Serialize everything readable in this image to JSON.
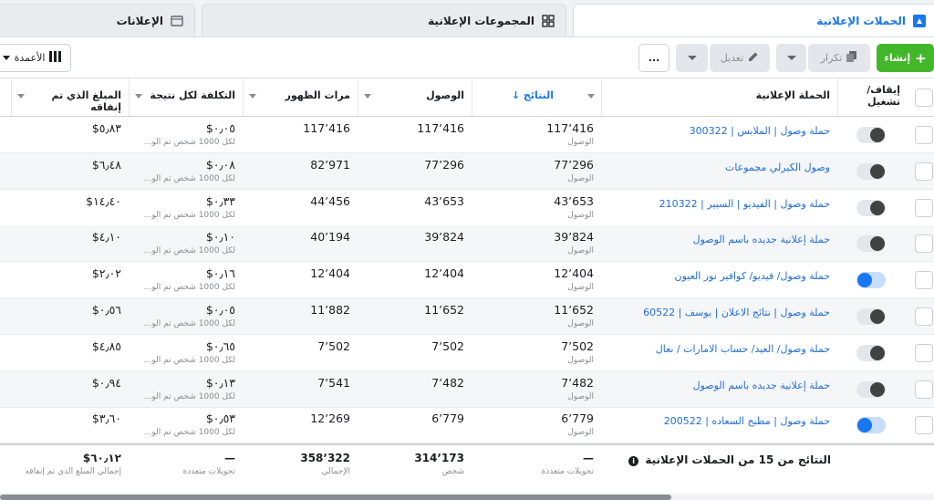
{
  "tabs": {
    "campaigns": "الحملات الإعلانية",
    "adsets": "المجموعات الإعلانية",
    "ads": "الإعلانات"
  },
  "toolbar": {
    "create": "إنشاء",
    "duplicate": "تكرار",
    "edit": "تعديل",
    "more": "...",
    "columns": "الأعمدة"
  },
  "headers": {
    "onoff": "إيقاف/تشغيل",
    "campaign": "الحملة الإعلانية",
    "results": "النتائج",
    "reach": "الوصول",
    "impressions": "مرات الظهور",
    "cost_per_result": "التكلفة لكل نتيجة",
    "amount_spent": "المبلغ الذي تم إنفاقه"
  },
  "rows": [
    {
      "name": "حملة وصول | الملابس | 300322",
      "on": false,
      "results": "117٬416",
      "results_sub": "الوصول",
      "reach": "117٬416",
      "impressions": "117٬416",
      "cost": "٠٫٠٥$",
      "cost_sub": "لكل 1000 شخص تم الو...",
      "spent": "٥٫٨٣$"
    },
    {
      "name": "وصول الكيرلي مجموعات",
      "on": false,
      "results": "77٬296",
      "results_sub": "الوصول",
      "reach": "77٬296",
      "impressions": "82٬971",
      "cost": "٠٫٠٨$",
      "cost_sub": "لكل 1000 شخص تم الو...",
      "spent": "٦٫٤٨$"
    },
    {
      "name": "حملة وصول | الفيديو | السبير | 210322",
      "on": false,
      "results": "43٬653",
      "results_sub": "الوصول",
      "reach": "43٬653",
      "impressions": "44٬456",
      "cost": "٠٫٣٣$",
      "cost_sub": "لكل 1000 شخص تم الو...",
      "spent": "١٤٫٤٠$"
    },
    {
      "name": "حملة إعلانية جديده باسم الوصول",
      "on": false,
      "results": "39٬824",
      "results_sub": "الوصول",
      "reach": "39٬824",
      "impressions": "40٬194",
      "cost": "٠٫١٠$",
      "cost_sub": "لكل 1000 شخص تم الو...",
      "spent": "٤٫١٠$"
    },
    {
      "name": "حملة وصول/ فيديو/ كوافير نور العيون",
      "on": true,
      "results": "12٬404",
      "results_sub": "الوصول",
      "reach": "12٬404",
      "impressions": "12٬404",
      "cost": "٠٫١٦$",
      "cost_sub": "لكل 1000 شخص تم الو...",
      "spent": "٢٫٠٢$"
    },
    {
      "name": "حملة وصول | نتائج الاعلان | يوسف | 60522",
      "on": false,
      "results": "11٬652",
      "results_sub": "الوصول",
      "reach": "11٬652",
      "impressions": "11٬882",
      "cost": "٠٫٠٥$",
      "cost_sub": "لكل 1000 شخص تم الو...",
      "spent": "٠٫٥٦$"
    },
    {
      "name": "حملة وصول/ العيد/ حساب الامارات / نعال",
      "on": false,
      "results": "7٬502",
      "results_sub": "الوصول",
      "reach": "7٬502",
      "impressions": "7٬502",
      "cost": "٠٫٦٥$",
      "cost_sub": "لكل 1000 شخص تم الو...",
      "spent": "٤٫٨٥$"
    },
    {
      "name": "حملة إعلانية جديده باسم الوصول",
      "on": false,
      "results": "7٬482",
      "results_sub": "الوصول",
      "reach": "7٬482",
      "impressions": "7٬541",
      "cost": "٠٫١٣$",
      "cost_sub": "لكل 1000 شخص تم الو...",
      "spent": "٠٫٩٤$"
    },
    {
      "name": "حملة وصول | مطبخ السعاده | 200522",
      "on": true,
      "results": "6٬779",
      "results_sub": "الوصول",
      "reach": "6٬779",
      "impressions": "12٬269",
      "cost": "٠٫٥٣$",
      "cost_sub": "لكل 1000 شخص تم الو...",
      "spent": "٣٫٦٠$"
    }
  ],
  "footer": {
    "summary": "النتائج من 15 من الحملات الإعلانية",
    "results": "—",
    "results_sub": "تحويلات متعددة",
    "reach": "314٬173",
    "reach_sub": "شخص",
    "impressions": "358٬322",
    "impressions_sub": "الإجمالي",
    "cost": "—",
    "cost_sub": "تحويلات متعددة",
    "spent": "٦٠٫١٢$",
    "spent_sub": "إجمالي المبلغ الذي تم إنفاقه"
  }
}
